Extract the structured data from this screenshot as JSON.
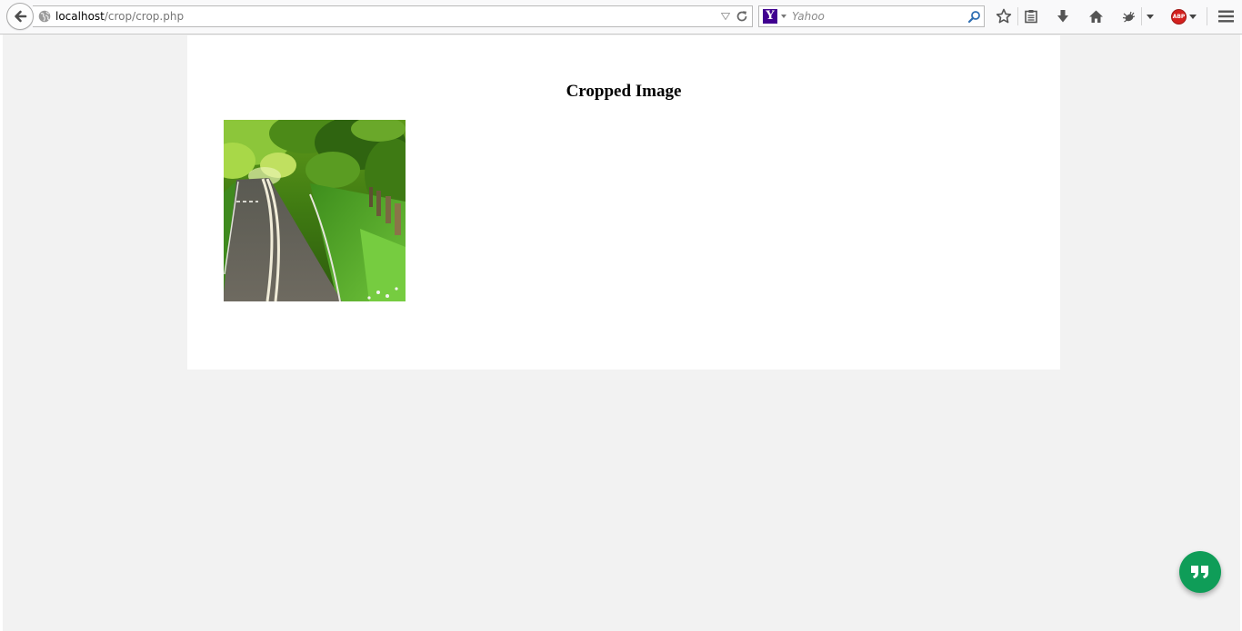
{
  "browser": {
    "url_host": "localhost",
    "url_path": "/crop/crop.php",
    "search_placeholder": "Yahoo",
    "search_engine_logo": "Y",
    "adblock_label": "ABP",
    "icons": {
      "back": "back-arrow-icon",
      "site_identity": "globe-icon",
      "url_dropdown": "dropdown-triangle-icon",
      "reload": "reload-icon",
      "search_go": "magnifier-icon",
      "bookmark": "star-icon",
      "reading_list": "clipboard-icon",
      "downloads": "download-arrow-icon",
      "home": "home-icon",
      "extension": "bug-icon",
      "adblock": "adblock-plus-icon",
      "menu": "hamburger-menu-icon"
    }
  },
  "page": {
    "heading": "Cropped Image",
    "image_description_icon": "cropped-road-photo"
  },
  "fab": {
    "icon": "quote-icon",
    "color": "#0f9d58"
  },
  "colors": {
    "page_background": "#f2f2f2",
    "card_background": "#ffffff",
    "yahoo_purple": "#400090",
    "abp_red": "#d4211e"
  }
}
